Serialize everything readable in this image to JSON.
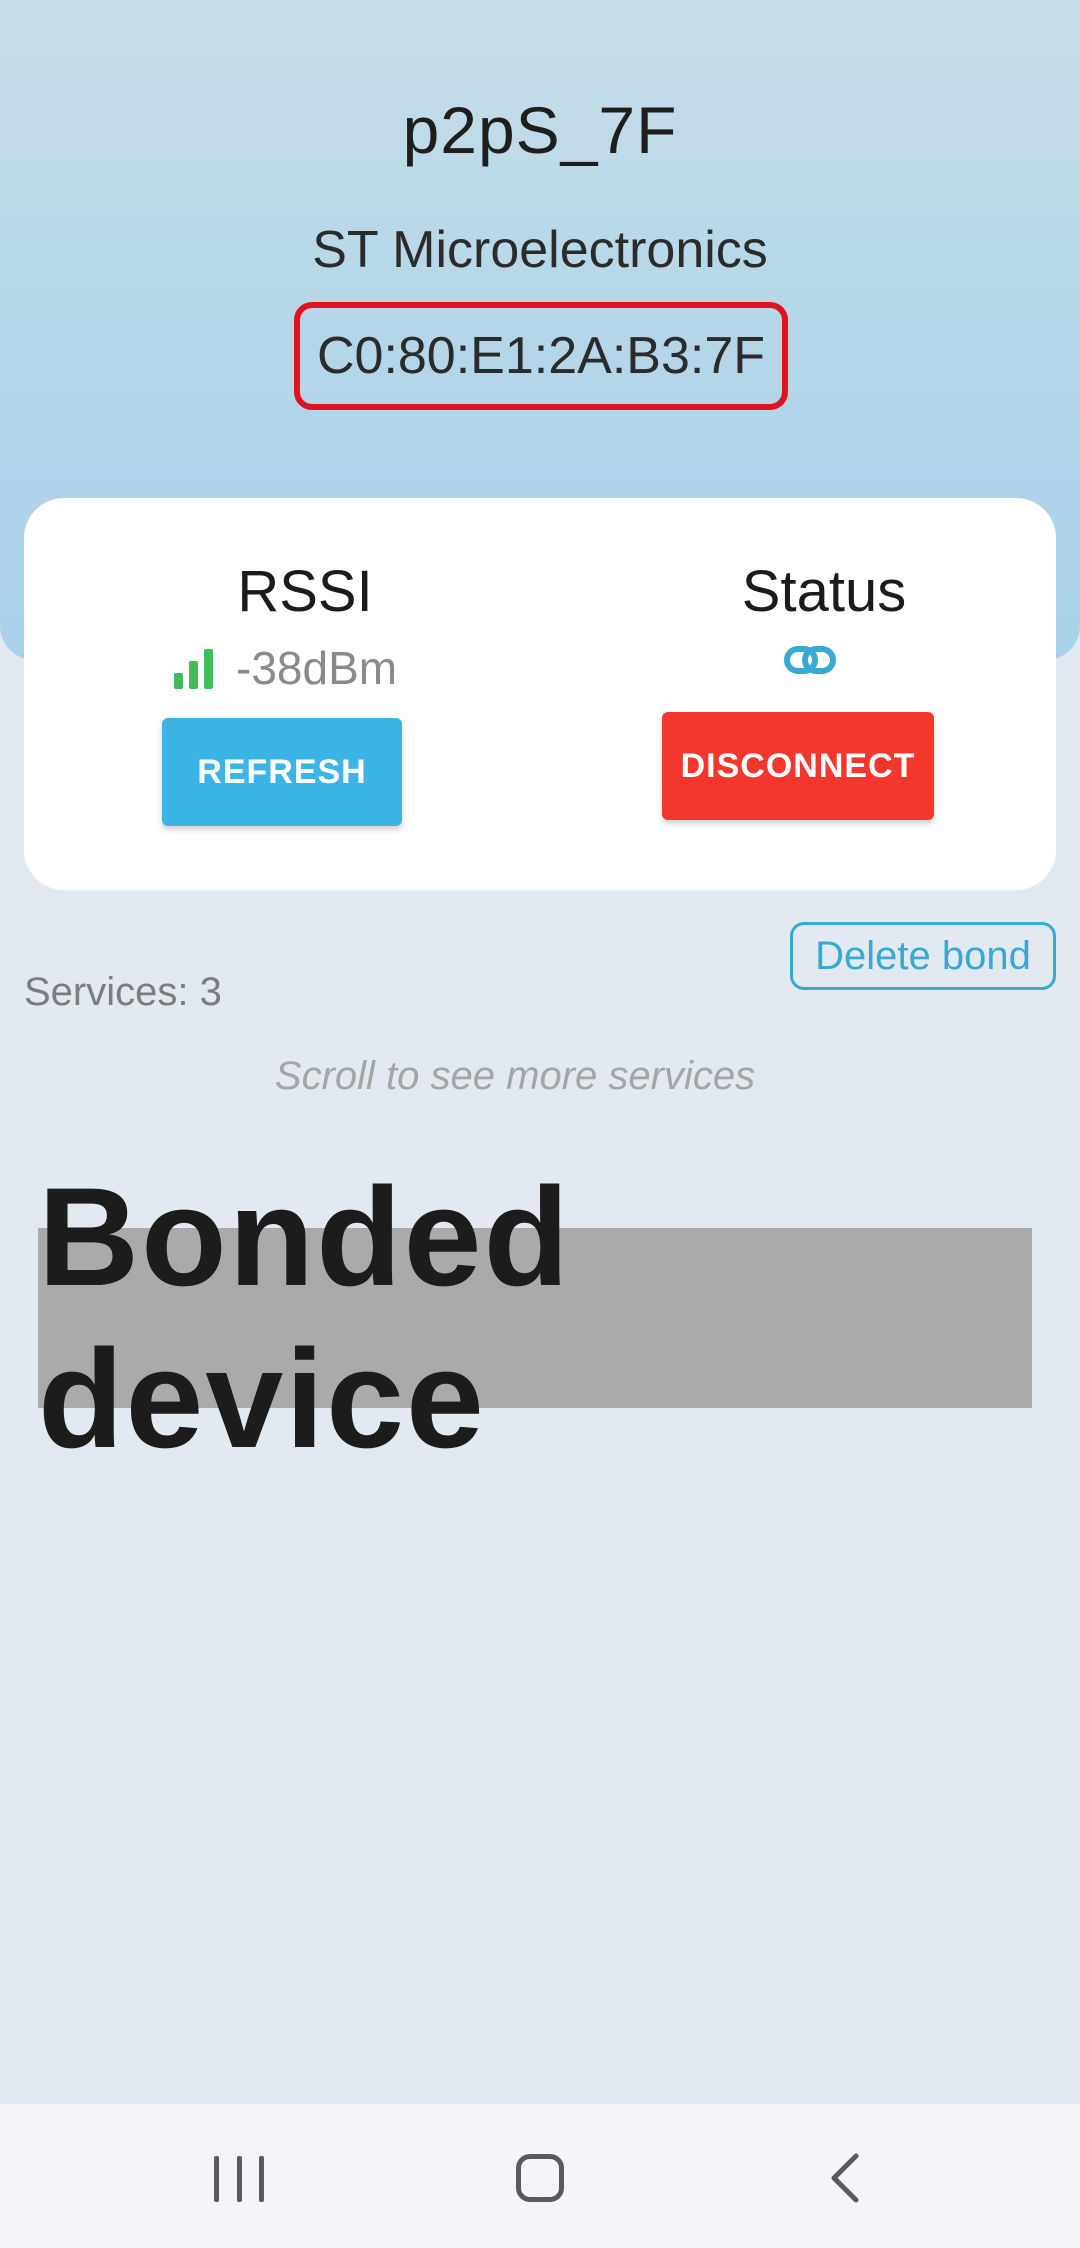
{
  "device": {
    "name": "p2pS_7F",
    "manufacturer": "ST Microelectronics",
    "mac_address": "C0:80:E1:2A:B3:7F"
  },
  "rssi": {
    "title": "RSSI",
    "value": "-38dBm",
    "icon": "signal-bars-icon"
  },
  "status": {
    "title": "Status",
    "icon": "link-icon"
  },
  "buttons": {
    "refresh": "REFRESH",
    "disconnect": "DISCONNECT",
    "delete_bond": "Delete bond"
  },
  "services": {
    "count_label": "Services: 3",
    "scroll_hint": "Scroll to see more services"
  },
  "overlay": {
    "label": "Bonded device"
  },
  "navbar": {
    "recent_icon": "recent-apps-icon",
    "home_icon": "home-icon",
    "back_icon": "back-icon"
  },
  "colors": {
    "refresh": "#3db4e6",
    "disconnect": "#f4372c",
    "signal": "#3fbd5c",
    "accent": "#36a9d4",
    "mac_highlight": "#e0121f"
  }
}
